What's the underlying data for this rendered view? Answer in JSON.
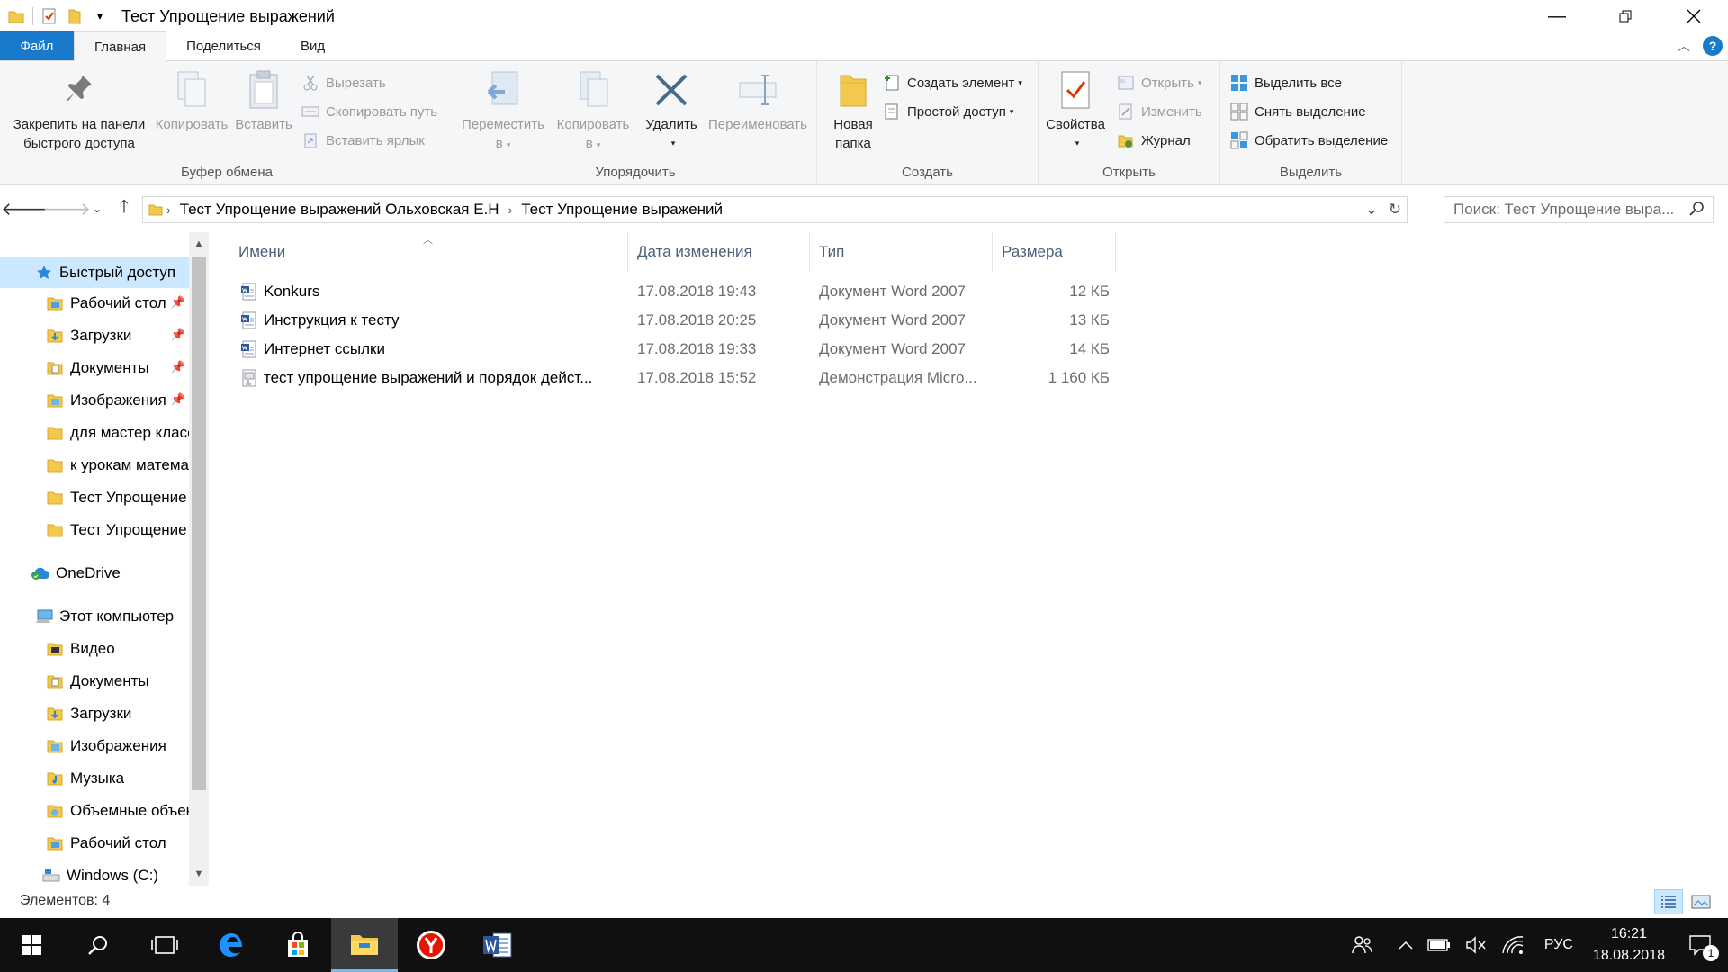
{
  "window": {
    "title": "Тест Упрощение выражений"
  },
  "ribbon_tabs": [
    {
      "label": "Файл"
    },
    {
      "label": "Главная"
    },
    {
      "label": "Поделиться"
    },
    {
      "label": "Вид"
    }
  ],
  "ribbon": {
    "clipboard": {
      "label": "Буфер обмена",
      "pin_line1": "Закрепить на панели",
      "pin_line2": "быстрого доступа",
      "copy": "Копировать",
      "paste": "Вставить",
      "cut": "Вырезать",
      "copy_path": "Скопировать путь",
      "paste_shortcut": "Вставить ярлык"
    },
    "organize": {
      "label": "Упорядочить",
      "move_line1": "Переместить",
      "move_line2": "в",
      "copy_line1": "Копировать",
      "copy_line2": "в",
      "delete": "Удалить",
      "rename": "Переименовать"
    },
    "create": {
      "label": "Создать",
      "new_folder_line1": "Новая",
      "new_folder_line2": "папка",
      "new_item": "Создать элемент",
      "easy_access": "Простой доступ"
    },
    "open": {
      "label": "Открыть",
      "properties": "Свойства",
      "open": "Открыть",
      "edit": "Изменить",
      "history": "Журнал"
    },
    "select": {
      "label": "Выделить",
      "select_all": "Выделить все",
      "select_none": "Снять выделение",
      "invert": "Обратить выделение"
    }
  },
  "address": {
    "crumbs": [
      "Тест Упрощение выражений Ольховская Е.Н",
      "Тест Упрощение выражений"
    ],
    "search_placeholder": "Поиск: Тест Упрощение выра..."
  },
  "navpane": {
    "items": [
      {
        "label": "Быстрый доступ",
        "icon": "star-icon"
      },
      {
        "label": "Рабочий стол",
        "icon": "folder-icon"
      },
      {
        "label": "Загрузки",
        "icon": "downloads-folder-icon"
      },
      {
        "label": "Документы",
        "icon": "documents-folder-icon"
      },
      {
        "label": "Изображения",
        "icon": "pictures-folder-icon"
      },
      {
        "label": "для мастер класса",
        "icon": "folder-icon"
      },
      {
        "label": "к урокам математики",
        "icon": "folder-icon"
      },
      {
        "label": "Тест Упрощение выражений",
        "icon": "folder-icon"
      },
      {
        "label": "Тест Упрощение выражений",
        "icon": "folder-icon"
      },
      {
        "label": "OneDrive",
        "icon": "onedrive-icon"
      },
      {
        "label": "Этот компьютер",
        "icon": "computer-icon"
      },
      {
        "label": "Видео",
        "icon": "video-folder-icon"
      },
      {
        "label": "Документы",
        "icon": "documents-folder-icon"
      },
      {
        "label": "Загрузки",
        "icon": "downloads-folder-icon"
      },
      {
        "label": "Изображения",
        "icon": "pictures-folder-icon"
      },
      {
        "label": "Музыка",
        "icon": "music-folder-icon"
      },
      {
        "label": "Объемные объекты",
        "icon": "3d-folder-icon"
      },
      {
        "label": "Рабочий стол",
        "icon": "desktop-folder-icon"
      },
      {
        "label": "Windows (C:)",
        "icon": "drive-icon"
      }
    ]
  },
  "filelist": {
    "columns": [
      "Имени",
      "Дата изменения",
      "Тип",
      "Размера"
    ],
    "rows": [
      {
        "name": "Konkurs",
        "date": "17.08.2018 19:43",
        "type": "Документ Word 2007",
        "size": "12 КБ",
        "icon": "word-doc-icon"
      },
      {
        "name": "Инструкция к тесту",
        "date": "17.08.2018 20:25",
        "type": "Документ Word 2007",
        "size": "13 КБ",
        "icon": "word-doc-icon"
      },
      {
        "name": "Интернет ссылки",
        "date": "17.08.2018 19:33",
        "type": "Документ Word 2007",
        "size": "14 КБ",
        "icon": "word-doc-icon"
      },
      {
        "name": "тест упрощение выражений и порядок дейст...",
        "date": "17.08.2018 15:52",
        "type": "Демонстрация Micro...",
        "size": "1 160 КБ",
        "icon": "powerpoint-show-icon"
      }
    ]
  },
  "status": {
    "items_count": "Элементов: 4"
  },
  "taskbar": {
    "language": "РУС",
    "time": "16:21",
    "date": "18.08.2018",
    "notification_count": "1"
  },
  "colors": {
    "accent": "#1979ca",
    "selection": "#cce8ff",
    "taskbar": "#101010"
  }
}
